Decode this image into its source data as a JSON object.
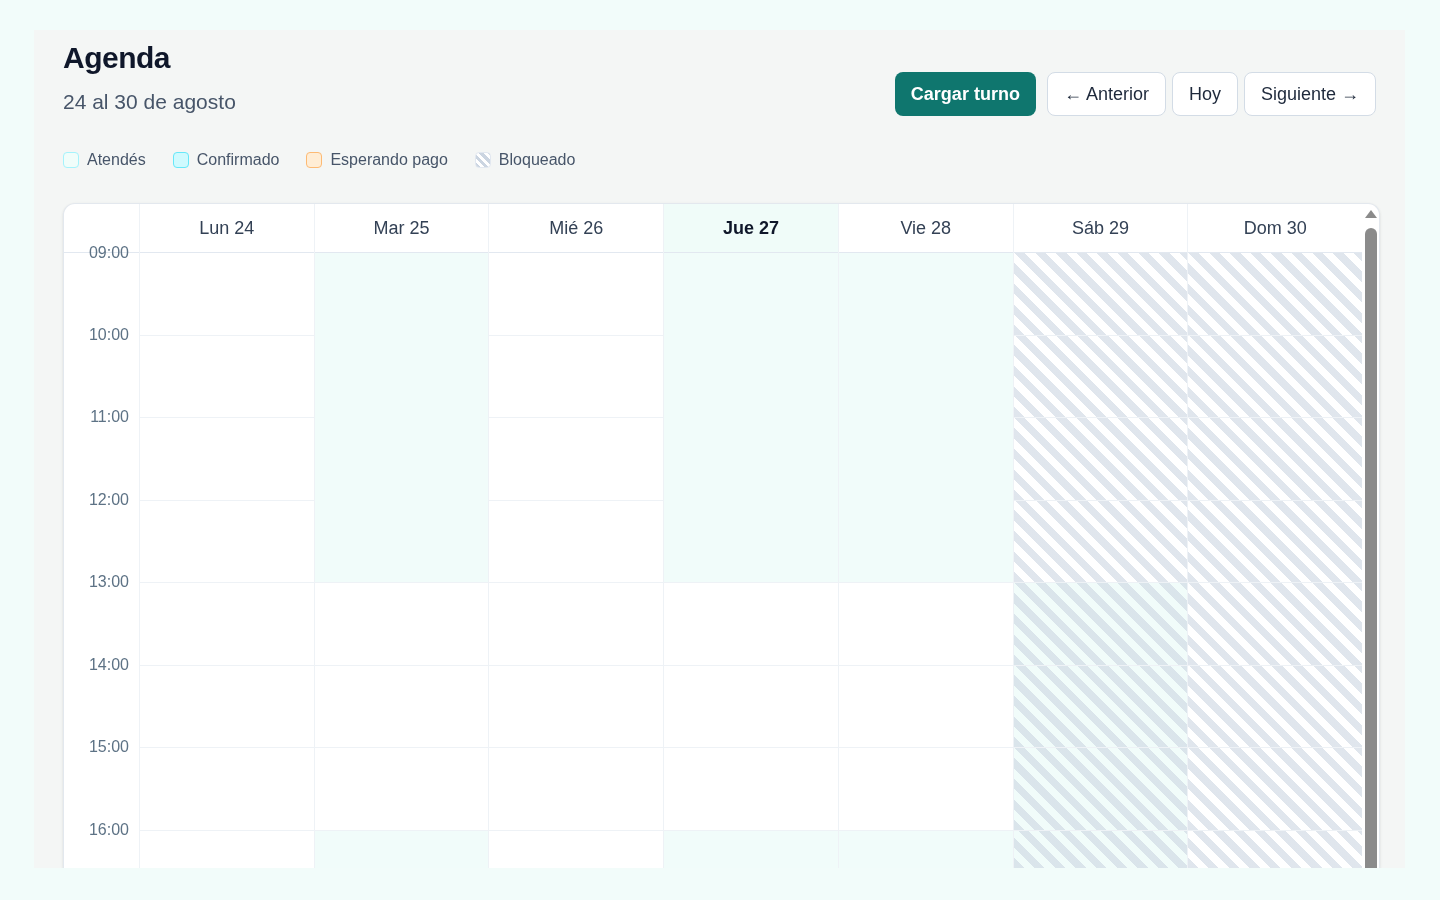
{
  "header": {
    "title": "Agenda",
    "subtitle": "24 al 30 de agosto"
  },
  "actions": [
    {
      "label": "Cargar turno",
      "kind": "primary"
    },
    {
      "label": "← Anterior",
      "kind": "secondary"
    },
    {
      "label": "Hoy",
      "kind": "secondary"
    },
    {
      "label": "Siguiente →",
      "kind": "secondary"
    }
  ],
  "legend": [
    {
      "label": "Atendés",
      "kind": "attends"
    },
    {
      "label": "Confirmado",
      "kind": "confirmed"
    },
    {
      "label": "Esperando pago",
      "kind": "pending"
    },
    {
      "label": "Bloqueado",
      "kind": "blocked"
    }
  ],
  "calendar": {
    "hours": [
      "09:00",
      "10:00",
      "11:00",
      "12:00",
      "13:00",
      "14:00",
      "15:00",
      "16:00"
    ],
    "days": [
      {
        "label": "Lun 24",
        "today": false,
        "kind": "open",
        "slots": [
          {
            "kind": "free"
          },
          {
            "kind": "free"
          },
          {
            "kind": "free"
          },
          {
            "kind": "free"
          },
          {
            "kind": "free"
          },
          {
            "kind": "free"
          },
          {
            "kind": "free"
          },
          {
            "kind": "free"
          }
        ]
      },
      {
        "label": "Mar 25",
        "today": false,
        "kind": "open",
        "slots": [
          {
            "kind": "attends"
          },
          {
            "kind": "attends"
          },
          {
            "kind": "attends"
          },
          {
            "kind": "attends"
          },
          {
            "kind": "free"
          },
          {
            "kind": "free"
          },
          {
            "kind": "free"
          },
          {
            "kind": "attends"
          }
        ]
      },
      {
        "label": "Mié 26",
        "today": false,
        "kind": "open",
        "slots": [
          {
            "kind": "free"
          },
          {
            "kind": "free"
          },
          {
            "kind": "free"
          },
          {
            "kind": "free"
          },
          {
            "kind": "free"
          },
          {
            "kind": "free"
          },
          {
            "kind": "free"
          },
          {
            "kind": "free"
          }
        ]
      },
      {
        "label": "Jue 27",
        "today": true,
        "kind": "open",
        "slots": [
          {
            "kind": "attends"
          },
          {
            "kind": "attends"
          },
          {
            "kind": "attends"
          },
          {
            "kind": "attends"
          },
          {
            "kind": "free"
          },
          {
            "kind": "free"
          },
          {
            "kind": "free"
          },
          {
            "kind": "attends"
          }
        ]
      },
      {
        "label": "Vie 28",
        "today": false,
        "kind": "open",
        "slots": [
          {
            "kind": "attends"
          },
          {
            "kind": "attends"
          },
          {
            "kind": "attends"
          },
          {
            "kind": "attends"
          },
          {
            "kind": "free"
          },
          {
            "kind": "free"
          },
          {
            "kind": "free"
          },
          {
            "kind": "attends"
          }
        ]
      },
      {
        "label": "Sáb 29",
        "today": false,
        "kind": "blocked",
        "slots": [
          {
            "kind": "free"
          },
          {
            "kind": "free"
          },
          {
            "kind": "free"
          },
          {
            "kind": "free"
          },
          {
            "kind": "attends"
          },
          {
            "kind": "attends"
          },
          {
            "kind": "attends"
          },
          {
            "kind": "attends"
          }
        ]
      },
      {
        "label": "Dom 30",
        "today": false,
        "kind": "blocked",
        "slots": [
          {
            "kind": "free"
          },
          {
            "kind": "free"
          },
          {
            "kind": "free"
          },
          {
            "kind": "free"
          },
          {
            "kind": "free"
          },
          {
            "kind": "free"
          },
          {
            "kind": "free"
          },
          {
            "kind": "free"
          }
        ]
      }
    ]
  }
}
